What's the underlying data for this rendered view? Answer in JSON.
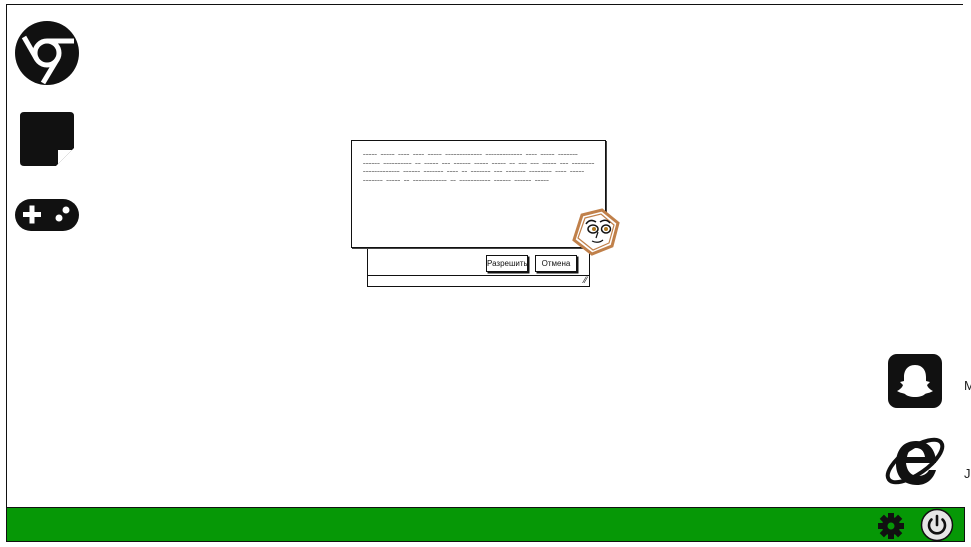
{
  "desktop": {
    "icons": [
      {
        "name": "chrome",
        "icon": "chrome-icon"
      },
      {
        "name": "notes",
        "icon": "sticky-note-icon"
      },
      {
        "name": "games",
        "icon": "gamepad-icon"
      },
      {
        "name": "snapchat",
        "icon": "snapchat-icon"
      },
      {
        "name": "internet-explorer",
        "icon": "internet-explorer-icon"
      }
    ],
    "edge_labels": [
      "M",
      "J"
    ]
  },
  "dialog": {
    "message": "~~~~~ ~~~~~ ~~~~ ~~~~ ~~~~~ ~~~~~~~~~~~~~ ~~~~~~~~~~~~~ ~~~~ ~~~~~ ~~~~~~~ ~~~~~~ ~~~~~~~~~~ ~~ ~~~~~ ~~~ ~~~~~~ ~~~~~ ~~~~~ ~~ ~~~ ~~~ ~~~~~ ~~~ ~~~~~~~~ ~~~~~~~~~~~~~ ~~~~~~ ~~~~~~~ ~~~~ ~~ ~~~~~~~ ~~~ ~~~~~~~ ~~~~~~~~ ~~~~ ~~~~~ ~~~~~~~ ~~~~~ ~~ ~~~~~~~~~~~~ ~~ ~~~~~~~~~~~ ~~~~~~ ~~~~~~ ~~~~~",
    "allow_label": "Разрешить",
    "cancel_label": "Отмена"
  },
  "taskbar": {
    "icons": [
      "gear-icon",
      "power-icon"
    ]
  },
  "colors": {
    "taskbar": "#069806",
    "mascot": "#c0804a",
    "ink": "#111111"
  }
}
